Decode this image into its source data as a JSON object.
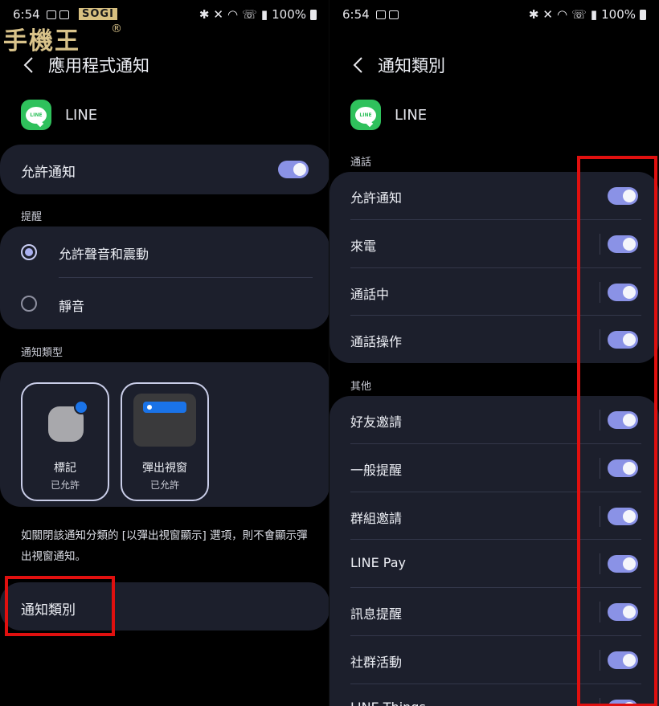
{
  "status": {
    "time": "6:54",
    "battery": "100%"
  },
  "watermark": {
    "sogi": "SOGI",
    "brand": "手機王",
    "reg": "®"
  },
  "left": {
    "title": "應用程式通知",
    "app_name": "LINE",
    "logo_text": "LINE",
    "allow_label": "允許通知",
    "allow_on": true,
    "reminder_section": "提醒",
    "options": [
      {
        "label": "允許聲音和震動",
        "selected": true
      },
      {
        "label": "靜音",
        "selected": false
      }
    ],
    "type_section": "通知類型",
    "tiles": [
      {
        "name": "標記",
        "status": "已允許"
      },
      {
        "name": "彈出視窗",
        "status": "已允許"
      }
    ],
    "info_text": "如關閉該通知分類的 [以彈出視窗顯示] 選項，則不會顯示彈出視窗通知。",
    "category_label": "通知類別"
  },
  "right": {
    "title": "通知類別",
    "app_name": "LINE",
    "logo_text": "LINE",
    "call_section": "通話",
    "call_items": [
      {
        "label": "允許通知",
        "on": true
      },
      {
        "label": "來電",
        "on": true
      },
      {
        "label": "通話中",
        "on": true
      },
      {
        "label": "通話操作",
        "on": true
      }
    ],
    "other_section": "其他",
    "other_items": [
      {
        "label": "好友邀請",
        "on": true
      },
      {
        "label": "一般提醒",
        "on": true
      },
      {
        "label": "群組邀請",
        "on": true
      },
      {
        "label": "LINE Pay",
        "on": true
      },
      {
        "label": "訊息提醒",
        "on": true
      },
      {
        "label": "社群活動",
        "on": true
      },
      {
        "label": "LINE Things",
        "on": true
      }
    ]
  },
  "colors": {
    "card": "#1c1f2c",
    "toggle_on": "#8a92e6",
    "highlight": "#e0100f",
    "line_green": "#2fc15c"
  }
}
